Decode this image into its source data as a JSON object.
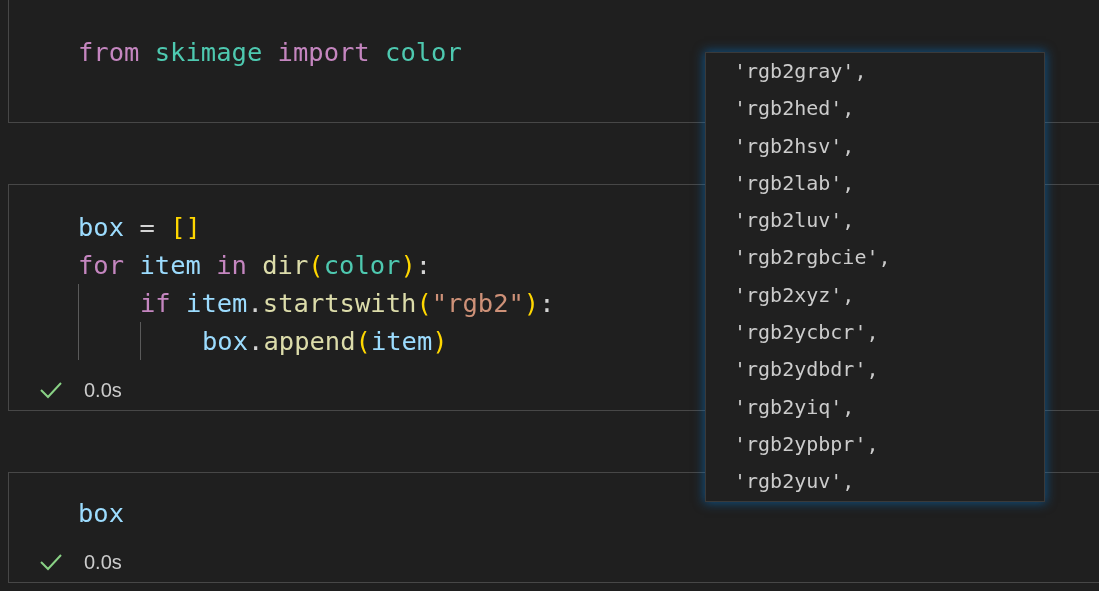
{
  "cells": [
    {
      "lines": [
        {
          "tokens": [
            {
              "kind": "keyword",
              "text": "from "
            },
            {
              "kind": "module",
              "text": "skimage "
            },
            {
              "kind": "keyword",
              "text": "import "
            },
            {
              "kind": "module",
              "text": "color"
            }
          ]
        }
      ]
    },
    {
      "lines": [
        {
          "tokens": [
            {
              "kind": "variable",
              "text": "box "
            },
            {
              "kind": "plain",
              "text": "= "
            },
            {
              "kind": "bracket",
              "text": "[]"
            }
          ]
        },
        {
          "tokens": [
            {
              "kind": "keyword",
              "text": "for "
            },
            {
              "kind": "variable",
              "text": "item "
            },
            {
              "kind": "keyword",
              "text": "in "
            },
            {
              "kind": "function",
              "text": "dir"
            },
            {
              "kind": "bracket",
              "text": "("
            },
            {
              "kind": "module",
              "text": "color"
            },
            {
              "kind": "bracket",
              "text": ")"
            },
            {
              "kind": "plain",
              "text": ":"
            }
          ],
          "children": [
            {
              "tokens": [
                {
                  "kind": "keyword",
                  "text": "if "
                },
                {
                  "kind": "variable",
                  "text": "item"
                },
                {
                  "kind": "plain",
                  "text": "."
                },
                {
                  "kind": "function",
                  "text": "startswith"
                },
                {
                  "kind": "bracket",
                  "text": "("
                },
                {
                  "kind": "string",
                  "text": "\"rgb2\""
                },
                {
                  "kind": "bracket",
                  "text": ")"
                },
                {
                  "kind": "plain",
                  "text": ":"
                }
              ],
              "children": [
                {
                  "tokens": [
                    {
                      "kind": "variable",
                      "text": "box"
                    },
                    {
                      "kind": "plain",
                      "text": "."
                    },
                    {
                      "kind": "function",
                      "text": "append"
                    },
                    {
                      "kind": "bracket",
                      "text": "("
                    },
                    {
                      "kind": "variable",
                      "text": "item"
                    },
                    {
                      "kind": "bracket",
                      "text": ")"
                    }
                  ]
                }
              ]
            }
          ]
        }
      ],
      "status": {
        "success": true,
        "time": "0.0s"
      }
    },
    {
      "lines": [
        {
          "tokens": [
            {
              "kind": "variable",
              "text": "box"
            }
          ]
        }
      ],
      "status": {
        "success": true,
        "time": "0.0s"
      }
    }
  ],
  "output_popup": {
    "items": [
      "'rgb2gray',",
      "'rgb2hed',",
      "'rgb2hsv',",
      "'rgb2lab',",
      "'rgb2luv',",
      "'rgb2rgbcie',",
      "'rgb2xyz',",
      "'rgb2ycbcr',",
      "'rgb2ydbdr',",
      "'rgb2yiq',",
      "'rgb2ypbpr',",
      "'rgb2yuv',"
    ]
  }
}
